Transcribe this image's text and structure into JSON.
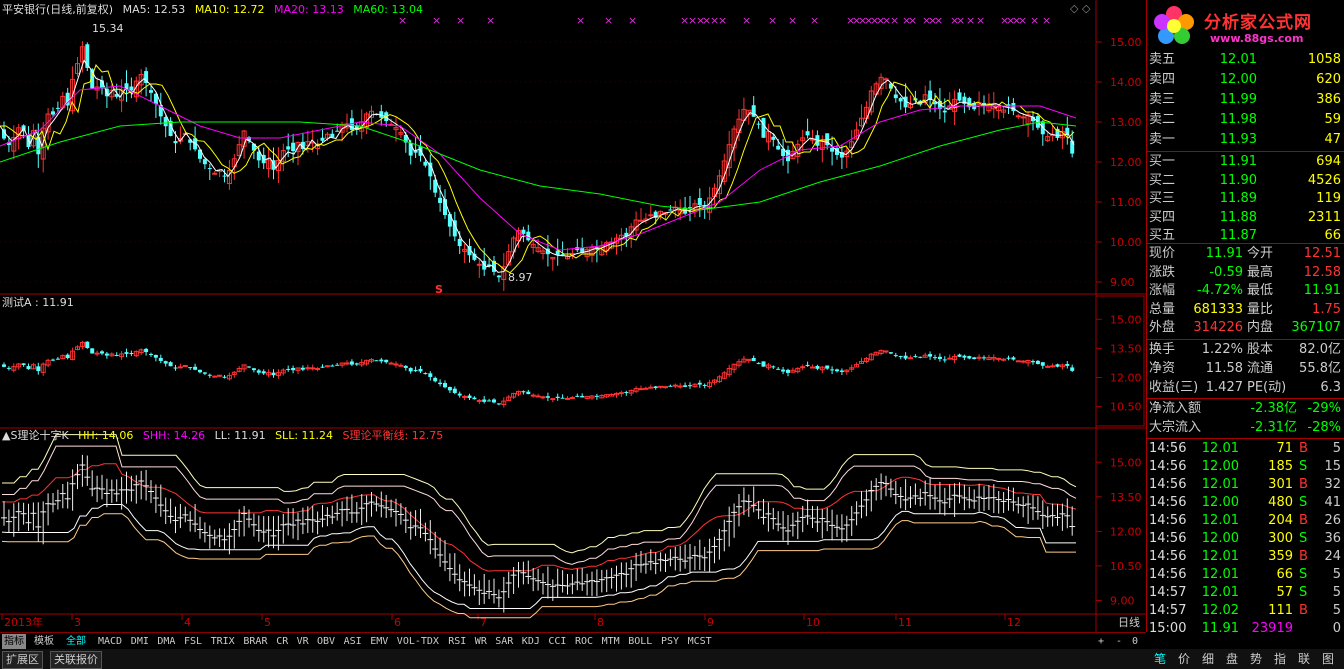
{
  "chart_header": {
    "main": {
      "title": "平安银行(日线,前复权)",
      "ma5": "MA5: 12.53",
      "ma10": "MA10: 12.72",
      "ma20": "MA20: 13.13",
      "ma60": "MA60: 13.04"
    },
    "sub1": {
      "title": "测试A : 11.91"
    },
    "sub2": {
      "title": "▲S理论十字K",
      "hh": "HH: 14.06",
      "shh": "SHH: 14.26",
      "ll": "LL: 11.91",
      "sll": "SLL: 11.24",
      "s": "S理论平衡线: 12.75"
    }
  },
  "annotations": {
    "high": "15.34",
    "low": "8.97",
    "s_marker": "S"
  },
  "colors": {
    "up": "#ff3232",
    "down": "#54ffff",
    "ma5": "#ffffff",
    "ma10": "#ffff00",
    "ma20": "#ff00ff",
    "ma60": "#00ff00",
    "grid": "#a00000"
  },
  "chart_data": {
    "type": "candlestick",
    "title": "平安银行(日线,前复权)",
    "main_yaxis": {
      "ticks": [
        "15.00",
        "14.00",
        "13.00",
        "12.00",
        "11.00",
        "10.00",
        "9.00"
      ],
      "ylim": [
        8.75,
        15.65
      ]
    },
    "sub1_yaxis": {
      "ticks": [
        "15.00",
        "13.50",
        "12.00",
        "10.50"
      ]
    },
    "sub2_yaxis": {
      "ticks": [
        "15.00",
        "13.50",
        "12.00",
        "10.50",
        "9.00"
      ]
    },
    "xaxis_labels": [
      "2013年",
      "3",
      "4",
      "5",
      "6",
      "7",
      "8",
      "9",
      "10",
      "11",
      "12"
    ],
    "xaxis_positions_note": "month boundaries",
    "price_path": [
      [
        0,
        12.9
      ],
      [
        6,
        12.6
      ],
      [
        12,
        12.4
      ],
      [
        18,
        12.7
      ],
      [
        24,
        13.0
      ],
      [
        30,
        12.3
      ],
      [
        36,
        12.8
      ],
      [
        40,
        12.1
      ],
      [
        46,
        12.9
      ],
      [
        52,
        13.3
      ],
      [
        58,
        13.1
      ],
      [
        64,
        13.7
      ],
      [
        70,
        13.4
      ],
      [
        76,
        14.2
      ],
      [
        82,
        14.6
      ],
      [
        86,
        15.0
      ],
      [
        90,
        14.3
      ],
      [
        96,
        13.7
      ],
      [
        102,
        14.0
      ],
      [
        108,
        13.6
      ],
      [
        114,
        13.8
      ],
      [
        120,
        13.6
      ],
      [
        126,
        13.9
      ],
      [
        132,
        13.7
      ],
      [
        138,
        14.0
      ],
      [
        144,
        14.2
      ],
      [
        150,
        13.9
      ],
      [
        156,
        13.6
      ],
      [
        162,
        13.2
      ],
      [
        168,
        12.9
      ],
      [
        174,
        12.6
      ],
      [
        180,
        12.4
      ],
      [
        186,
        12.8
      ],
      [
        192,
        12.5
      ],
      [
        198,
        12.3
      ],
      [
        204,
        12.0
      ],
      [
        210,
        11.9
      ],
      [
        216,
        11.7
      ],
      [
        222,
        11.8
      ],
      [
        228,
        11.6
      ],
      [
        234,
        11.9
      ],
      [
        240,
        12.3
      ],
      [
        246,
        12.8
      ],
      [
        252,
        12.5
      ],
      [
        258,
        12.2
      ],
      [
        264,
        11.9
      ],
      [
        270,
        12.1
      ],
      [
        276,
        11.8
      ],
      [
        282,
        12.1
      ],
      [
        288,
        12.4
      ],
      [
        294,
        12.2
      ],
      [
        300,
        12.5
      ],
      [
        306,
        12.3
      ],
      [
        312,
        12.6
      ],
      [
        318,
        12.4
      ],
      [
        324,
        12.5
      ],
      [
        330,
        12.7
      ],
      [
        336,
        12.6
      ],
      [
        342,
        12.9
      ],
      [
        348,
        13.0
      ],
      [
        354,
        12.8
      ],
      [
        360,
        12.8
      ],
      [
        366,
        13.1
      ],
      [
        372,
        13.3
      ],
      [
        378,
        13.2
      ],
      [
        384,
        13.1
      ],
      [
        390,
        13.0
      ],
      [
        396,
        12.9
      ],
      [
        402,
        12.8
      ],
      [
        408,
        12.5
      ],
      [
        414,
        12.1
      ],
      [
        420,
        12.3
      ],
      [
        426,
        12.0
      ],
      [
        432,
        11.7
      ],
      [
        438,
        11.2
      ],
      [
        444,
        10.9
      ],
      [
        450,
        10.5
      ],
      [
        456,
        10.2
      ],
      [
        462,
        9.9
      ],
      [
        468,
        9.8
      ],
      [
        474,
        9.6
      ],
      [
        480,
        9.5
      ],
      [
        486,
        9.3
      ],
      [
        492,
        9.4
      ],
      [
        498,
        9.2
      ],
      [
        502,
        9.1
      ],
      [
        508,
        9.5
      ],
      [
        514,
        10.0
      ],
      [
        520,
        10.3
      ],
      [
        526,
        10.2
      ],
      [
        532,
        10.0
      ],
      [
        538,
        9.9
      ],
      [
        544,
        9.8
      ],
      [
        550,
        9.7
      ],
      [
        556,
        9.6
      ],
      [
        562,
        9.7
      ],
      [
        568,
        9.6
      ],
      [
        574,
        9.7
      ],
      [
        580,
        9.8
      ],
      [
        586,
        9.7
      ],
      [
        592,
        9.9
      ],
      [
        598,
        9.8
      ],
      [
        604,
        9.9
      ],
      [
        610,
        10.0
      ],
      [
        616,
        10.0
      ],
      [
        622,
        10.2
      ],
      [
        628,
        10.1
      ],
      [
        634,
        10.4
      ],
      [
        640,
        10.6
      ],
      [
        646,
        10.5
      ],
      [
        652,
        10.7
      ],
      [
        658,
        10.6
      ],
      [
        664,
        10.8
      ],
      [
        670,
        10.7
      ],
      [
        676,
        10.9
      ],
      [
        682,
        10.8
      ],
      [
        688,
        10.7
      ],
      [
        694,
        10.9
      ],
      [
        700,
        11.0
      ],
      [
        706,
        10.8
      ],
      [
        712,
        11.1
      ],
      [
        718,
        11.4
      ],
      [
        724,
        11.8
      ],
      [
        730,
        12.3
      ],
      [
        736,
        12.8
      ],
      [
        742,
        13.1
      ],
      [
        748,
        13.4
      ],
      [
        754,
        13.2
      ],
      [
        760,
        13.0
      ],
      [
        766,
        12.6
      ],
      [
        772,
        12.8
      ],
      [
        778,
        12.4
      ],
      [
        784,
        12.2
      ],
      [
        790,
        12.0
      ],
      [
        796,
        12.3
      ],
      [
        802,
        12.5
      ],
      [
        808,
        12.7
      ],
      [
        814,
        12.6
      ],
      [
        820,
        12.4
      ],
      [
        826,
        12.6
      ],
      [
        832,
        12.3
      ],
      [
        838,
        12.2
      ],
      [
        844,
        12.1
      ],
      [
        850,
        12.3
      ],
      [
        856,
        12.6
      ],
      [
        862,
        13.0
      ],
      [
        868,
        13.3
      ],
      [
        874,
        13.8
      ],
      [
        880,
        14.0
      ],
      [
        886,
        14.2
      ],
      [
        892,
        13.9
      ],
      [
        898,
        13.6
      ],
      [
        904,
        13.5
      ],
      [
        910,
        13.3
      ],
      [
        916,
        13.6
      ],
      [
        922,
        13.4
      ],
      [
        928,
        13.7
      ],
      [
        934,
        13.5
      ],
      [
        940,
        13.4
      ],
      [
        946,
        13.2
      ],
      [
        952,
        13.4
      ],
      [
        958,
        13.6
      ],
      [
        964,
        13.5
      ],
      [
        970,
        13.4
      ],
      [
        976,
        13.3
      ],
      [
        982,
        13.5
      ],
      [
        988,
        13.4
      ],
      [
        994,
        13.5
      ],
      [
        1000,
        13.4
      ],
      [
        1006,
        13.3
      ],
      [
        1012,
        13.4
      ],
      [
        1018,
        13.2
      ],
      [
        1024,
        13.1
      ],
      [
        1030,
        13.2
      ],
      [
        1036,
        13.0
      ],
      [
        1042,
        12.8
      ],
      [
        1048,
        12.6
      ],
      [
        1054,
        12.7
      ],
      [
        1060,
        12.6
      ],
      [
        1066,
        12.8
      ],
      [
        1072,
        12.6
      ],
      [
        1076,
        12.0
      ]
    ],
    "ma60_path": [
      [
        0,
        12.0
      ],
      [
        60,
        12.5
      ],
      [
        120,
        12.9
      ],
      [
        180,
        13.0
      ],
      [
        240,
        13.0
      ],
      [
        300,
        13.0
      ],
      [
        360,
        12.9
      ],
      [
        420,
        12.4
      ],
      [
        480,
        11.8
      ],
      [
        540,
        11.4
      ],
      [
        600,
        11.2
      ],
      [
        660,
        10.9
      ],
      [
        700,
        10.8
      ],
      [
        760,
        11.0
      ],
      [
        820,
        11.5
      ],
      [
        880,
        11.9
      ],
      [
        940,
        12.4
      ],
      [
        1000,
        12.8
      ],
      [
        1040,
        13.0
      ],
      [
        1076,
        12.9
      ]
    ],
    "ma20_path": [
      [
        0,
        12.4
      ],
      [
        40,
        12.8
      ],
      [
        80,
        13.8
      ],
      [
        120,
        13.9
      ],
      [
        160,
        13.4
      ],
      [
        200,
        12.9
      ],
      [
        240,
        12.6
      ],
      [
        280,
        12.6
      ],
      [
        320,
        12.8
      ],
      [
        360,
        13.0
      ],
      [
        400,
        12.9
      ],
      [
        440,
        12.2
      ],
      [
        480,
        11.1
      ],
      [
        520,
        10.2
      ],
      [
        560,
        9.8
      ],
      [
        600,
        9.9
      ],
      [
        640,
        10.2
      ],
      [
        680,
        10.6
      ],
      [
        720,
        11.0
      ],
      [
        760,
        11.8
      ],
      [
        800,
        12.3
      ],
      [
        840,
        12.4
      ],
      [
        880,
        13.0
      ],
      [
        920,
        13.3
      ],
      [
        960,
        13.4
      ],
      [
        1000,
        13.4
      ],
      [
        1040,
        13.4
      ],
      [
        1076,
        13.1
      ]
    ]
  },
  "quote_panel": {
    "logo": {
      "title": "分析家公式网",
      "url": "www.88gs.com"
    },
    "ask": [
      {
        "label": "卖五",
        "price": "12.01",
        "vol": "1058"
      },
      {
        "label": "卖四",
        "price": "12.00",
        "vol": "620"
      },
      {
        "label": "卖三",
        "price": "11.99",
        "vol": "386"
      },
      {
        "label": "卖二",
        "price": "11.98",
        "vol": "59"
      },
      {
        "label": "卖一",
        "price": "11.93",
        "vol": "47"
      }
    ],
    "bid": [
      {
        "label": "买一",
        "price": "11.91",
        "vol": "694"
      },
      {
        "label": "买二",
        "price": "11.90",
        "vol": "4526"
      },
      {
        "label": "买三",
        "price": "11.89",
        "vol": "119"
      },
      {
        "label": "买四",
        "price": "11.88",
        "vol": "2311"
      },
      {
        "label": "买五",
        "price": "11.87",
        "vol": "66"
      }
    ],
    "stats": [
      {
        "l1": "现价",
        "v1": "11.91",
        "l2": "今开",
        "v2": "12.51"
      },
      {
        "l1": "涨跌",
        "v1": "-0.59",
        "l2": "最高",
        "v2": "12.58"
      },
      {
        "l1": "涨幅",
        "v1": "-4.72%",
        "l2": "最低",
        "v2": "11.91"
      },
      {
        "l1": "总量",
        "v1": "681333",
        "l2": "量比",
        "v2": "1.75"
      },
      {
        "l1": "外盘",
        "v1": "314226",
        "l2": "内盘",
        "v2": "367107"
      }
    ],
    "stats2": [
      {
        "l1": "换手",
        "v1": "1.22%",
        "l2": "股本",
        "v2": "82.0亿"
      },
      {
        "l1": "净资",
        "v1": "11.58",
        "l2": "流通",
        "v2": "55.8亿"
      },
      {
        "l1": "收益(三)",
        "v1": "1.427",
        "l2": "PE(动)",
        "v2": "6.3"
      }
    ],
    "flow": [
      {
        "l": "净流入额",
        "v": "-2.38亿",
        "p": "-29%"
      },
      {
        "l": "大宗流入",
        "v": "-2.31亿",
        "p": "-28%"
      }
    ],
    "ticks": [
      {
        "t": "14:56",
        "p": "12.01",
        "v": "71",
        "bs": "B",
        "n": "5"
      },
      {
        "t": "14:56",
        "p": "12.00",
        "v": "185",
        "bs": "S",
        "n": "15"
      },
      {
        "t": "14:56",
        "p": "12.01",
        "v": "301",
        "bs": "B",
        "n": "32"
      },
      {
        "t": "14:56",
        "p": "12.00",
        "v": "480",
        "bs": "S",
        "n": "41"
      },
      {
        "t": "14:56",
        "p": "12.01",
        "v": "204",
        "bs": "B",
        "n": "26"
      },
      {
        "t": "14:56",
        "p": "12.00",
        "v": "300",
        "bs": "S",
        "n": "36"
      },
      {
        "t": "14:56",
        "p": "12.01",
        "v": "359",
        "bs": "B",
        "n": "24"
      },
      {
        "t": "14:56",
        "p": "12.01",
        "v": "66",
        "bs": "S",
        "n": "5"
      },
      {
        "t": "14:57",
        "p": "12.01",
        "v": "57",
        "bs": "S",
        "n": "5"
      },
      {
        "t": "14:57",
        "p": "12.02",
        "v": "111",
        "bs": "B",
        "n": "5"
      },
      {
        "t": "15:00",
        "p": "11.91",
        "v": "23919",
        "bs": "",
        "n": "0"
      }
    ],
    "right_tabs": [
      "笔",
      "价",
      "细",
      "盘",
      "势",
      "指",
      "联",
      "图"
    ]
  },
  "bottom": {
    "indicator_tabs": [
      "指标",
      "模板",
      "全部",
      "MACD",
      "DMI",
      "DMA",
      "FSL",
      "TRIX",
      "BRAR",
      "CR",
      "VR",
      "OBV",
      "ASI",
      "EMV",
      "VOL-TDX",
      "RSI",
      "WR",
      "SAR",
      "KDJ",
      "CCI",
      "ROC",
      "MTM",
      "BOLL",
      "PSY",
      "MCST"
    ],
    "right_controls": [
      "+",
      "-",
      "0"
    ],
    "period_label": "日线",
    "lower_tabs": [
      "扩展区",
      "关联报价"
    ]
  }
}
